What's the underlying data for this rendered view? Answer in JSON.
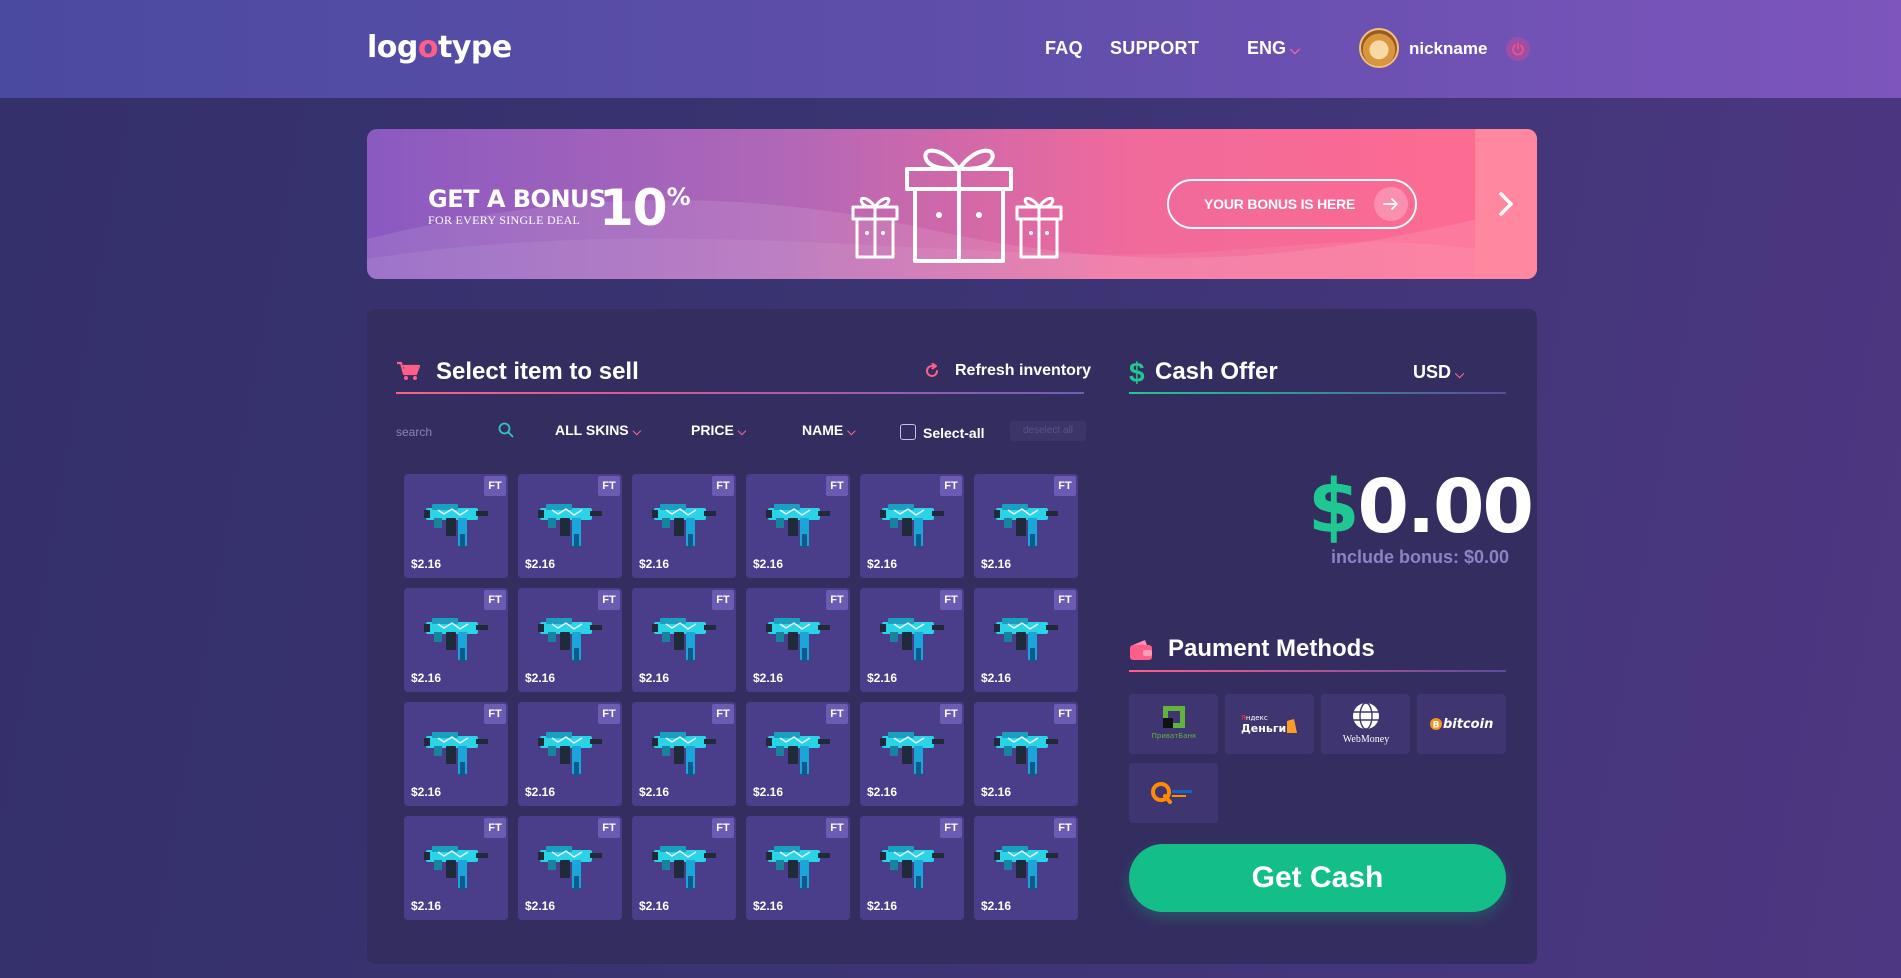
{
  "header": {
    "logo": {
      "part1": "lo",
      "part2": "g",
      "part3": "o",
      "part4": "type"
    },
    "nav": {
      "faq": "FAQ",
      "support": "SUPPORT"
    },
    "language": "ENG",
    "user": {
      "nickname": "nickname"
    }
  },
  "banner": {
    "title": "GET A BONUS",
    "subtitle": "FOR EVERY SINGLE DEAL",
    "percent": "10",
    "percent_sign": "%",
    "cta": "YOUR BONUS IS HERE"
  },
  "inventory": {
    "title": "Select item to sell",
    "refresh": "Refresh inventory",
    "search_placeholder": "search",
    "filters": {
      "skins": "ALL SKINS",
      "price": "PRICE",
      "name": "NAME"
    },
    "select_all": "Select-all",
    "deselect_all": "deselect all",
    "items": [
      {
        "price": "$2.16",
        "wear": "FT"
      },
      {
        "price": "$2.16",
        "wear": "FT"
      },
      {
        "price": "$2.16",
        "wear": "FT"
      },
      {
        "price": "$2.16",
        "wear": "FT"
      },
      {
        "price": "$2.16",
        "wear": "FT"
      },
      {
        "price": "$2.16",
        "wear": "FT"
      },
      {
        "price": "$2.16",
        "wear": "FT"
      },
      {
        "price": "$2.16",
        "wear": "FT"
      },
      {
        "price": "$2.16",
        "wear": "FT"
      },
      {
        "price": "$2.16",
        "wear": "FT"
      },
      {
        "price": "$2.16",
        "wear": "FT"
      },
      {
        "price": "$2.16",
        "wear": "FT"
      },
      {
        "price": "$2.16",
        "wear": "FT"
      },
      {
        "price": "$2.16",
        "wear": "FT"
      },
      {
        "price": "$2.16",
        "wear": "FT"
      },
      {
        "price": "$2.16",
        "wear": "FT"
      },
      {
        "price": "$2.16",
        "wear": "FT"
      },
      {
        "price": "$2.16",
        "wear": "FT"
      },
      {
        "price": "$2.16",
        "wear": "FT"
      },
      {
        "price": "$2.16",
        "wear": "FT"
      },
      {
        "price": "$2.16",
        "wear": "FT"
      },
      {
        "price": "$2.16",
        "wear": "FT"
      },
      {
        "price": "$2.16",
        "wear": "FT"
      },
      {
        "price": "$2.16",
        "wear": "FT"
      }
    ]
  },
  "cash_offer": {
    "title": "Cash Offer",
    "currency": "USD",
    "amount_symbol": "$",
    "amount": "0.00",
    "bonus_line": "include bonus: $0.00"
  },
  "payment": {
    "title": "Paument Methods",
    "methods": [
      {
        "name": "privatbank-logo",
        "label": "ПриватБанк"
      },
      {
        "name": "yandex-money-logo",
        "label": "Яндекс Деньги"
      },
      {
        "name": "webmoney-logo",
        "label": "WebMoney"
      },
      {
        "name": "bitcoin-logo",
        "label": "bitcoin"
      },
      {
        "name": "qiwi-logo",
        "label": "QIWI"
      }
    ],
    "submit": "Get Cash"
  },
  "colors": {
    "accent_pink": "#ff5e8a",
    "accent_green": "#14be88",
    "panel_bg": "#342d60",
    "item_bg": "#4a3e8b"
  }
}
